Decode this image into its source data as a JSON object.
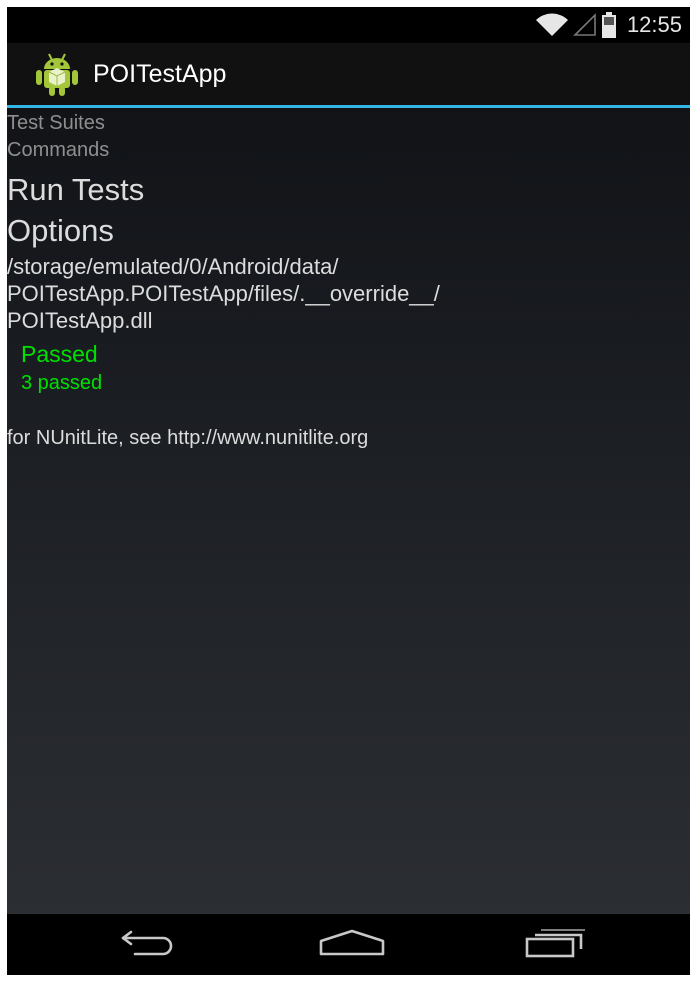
{
  "status_bar": {
    "time": "12:55",
    "icons": [
      "wifi-icon",
      "signal-icon",
      "battery-icon"
    ]
  },
  "action_bar": {
    "title": "POITestApp",
    "icon": "android-app-icon",
    "accent_color": "#33b5e5"
  },
  "content": {
    "test_suites_label": "Test Suites",
    "commands_label": "Commands",
    "run_tests_label": "Run Tests",
    "options_label": "Options",
    "path_lines": [
      "/storage/emulated/0/Android/data/",
      "POITestApp.POITestApp/files/.__override__/",
      "POITestApp.dll"
    ],
    "result_status": "Passed",
    "result_count": "3 passed",
    "result_color": "#00e000",
    "footer_note": "for NUnitLite, see http://www.nunitlite.org"
  },
  "nav_bar": {
    "buttons": [
      "back-icon",
      "home-icon",
      "recents-icon"
    ]
  }
}
